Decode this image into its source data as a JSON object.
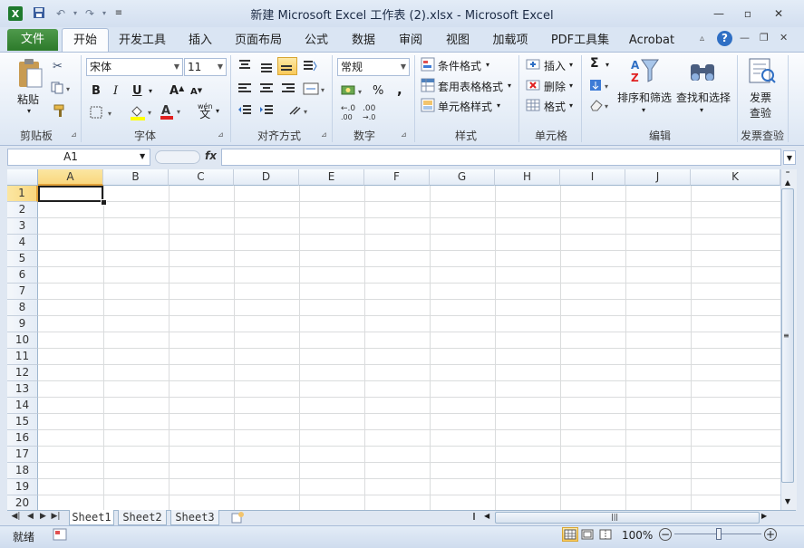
{
  "window": {
    "title": "新建 Microsoft Excel 工作表 (2).xlsx - Microsoft Excel"
  },
  "tabs": [
    "开始",
    "开发工具",
    "插入",
    "页面布局",
    "公式",
    "数据",
    "审阅",
    "视图",
    "加载项",
    "PDF工具集",
    "Acrobat"
  ],
  "file_tab": "文件",
  "ribbon": {
    "clipboard": {
      "paste": "粘贴",
      "label": "剪贴板"
    },
    "font": {
      "name": "宋体",
      "size": "11",
      "label": "字体",
      "bold": "B",
      "italic": "I",
      "underline": "U",
      "wen": "wén",
      "wen2": "文"
    },
    "alignment": {
      "label": "对齐方式"
    },
    "number": {
      "format": "常规",
      "label": "数字",
      "percent": "%",
      "comma": ",",
      "inc": "+.0",
      "dec": ".00"
    },
    "styles": {
      "conditional": "条件格式",
      "table": "套用表格格式",
      "cell": "单元格样式",
      "label": "样式"
    },
    "cells": {
      "insert": "插入",
      "delete": "删除",
      "format": "格式",
      "label": "单元格"
    },
    "editing": {
      "sort": "排序和筛选",
      "find": "查找和选择",
      "label": "编辑",
      "sigma": "Σ"
    },
    "invoice": {
      "line1": "发票",
      "line2": "查验",
      "label": "发票查验"
    }
  },
  "formula_bar": {
    "name_box": "A1",
    "fx": "fx",
    "value": ""
  },
  "columns": [
    "A",
    "B",
    "C",
    "D",
    "E",
    "F",
    "G",
    "H",
    "I",
    "J",
    "K"
  ],
  "rows": [
    "1",
    "2",
    "3",
    "4",
    "5",
    "6",
    "7",
    "8",
    "9",
    "10",
    "11",
    "12",
    "13",
    "14",
    "15",
    "16",
    "17",
    "18",
    "19",
    "20"
  ],
  "sheets": [
    "Sheet1",
    "Sheet2",
    "Sheet3"
  ],
  "status": {
    "ready": "就绪",
    "zoom": "100%"
  },
  "colors": {
    "file_tab": "#2c7a2a",
    "selected_header": "#f9d77e",
    "gridline": "#dadcdd"
  }
}
